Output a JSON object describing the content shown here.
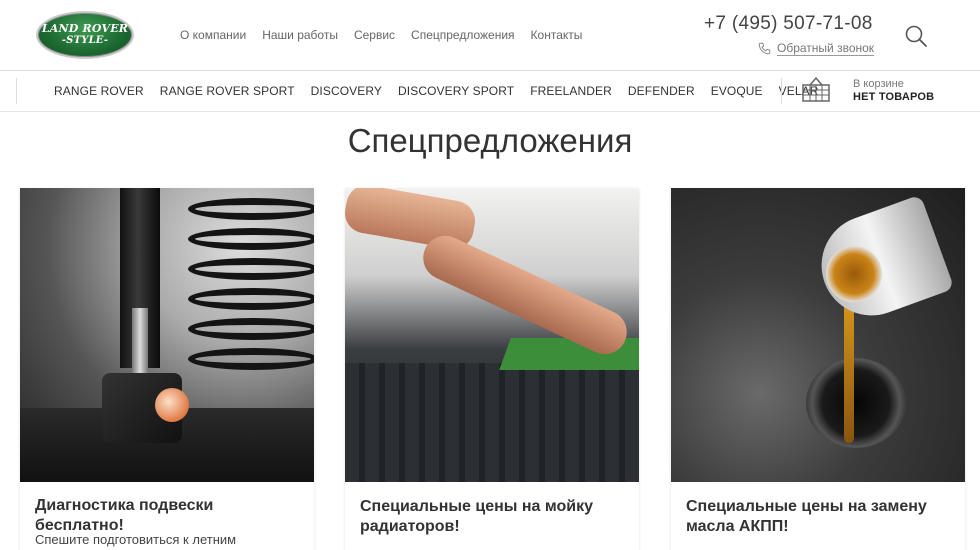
{
  "header": {
    "logo_line1": "LAND ROVER",
    "logo_line2": "-STYLE-",
    "nav": [
      "О компании",
      "Наши работы",
      "Сервис",
      "Спецпредложения",
      "Контакты"
    ],
    "phone": "+7 (495) 507-71-08",
    "callback": "Обратный звонок"
  },
  "models": [
    "RANGE ROVER",
    "RANGE ROVER SPORT",
    "DISCOVERY",
    "DISCOVERY SPORT",
    "FREELANDER",
    "DEFENDER",
    "EVOQUE",
    "VELAR"
  ],
  "cart": {
    "label": "В корзине",
    "status": "НЕТ ТОВАРОВ"
  },
  "page": {
    "title": "Спецпредложения"
  },
  "offers": [
    {
      "title": "Диагностика подвески бесплатно!",
      "text": "Спешите подготовиться к летним"
    },
    {
      "title": "Специальные цены на мойку радиаторов!"
    },
    {
      "title": "Специальные цены на замену масла АКПП!"
    }
  ],
  "colors": {
    "logo_green": "#1e6c33",
    "text": "#333333",
    "muted": "#666666"
  }
}
